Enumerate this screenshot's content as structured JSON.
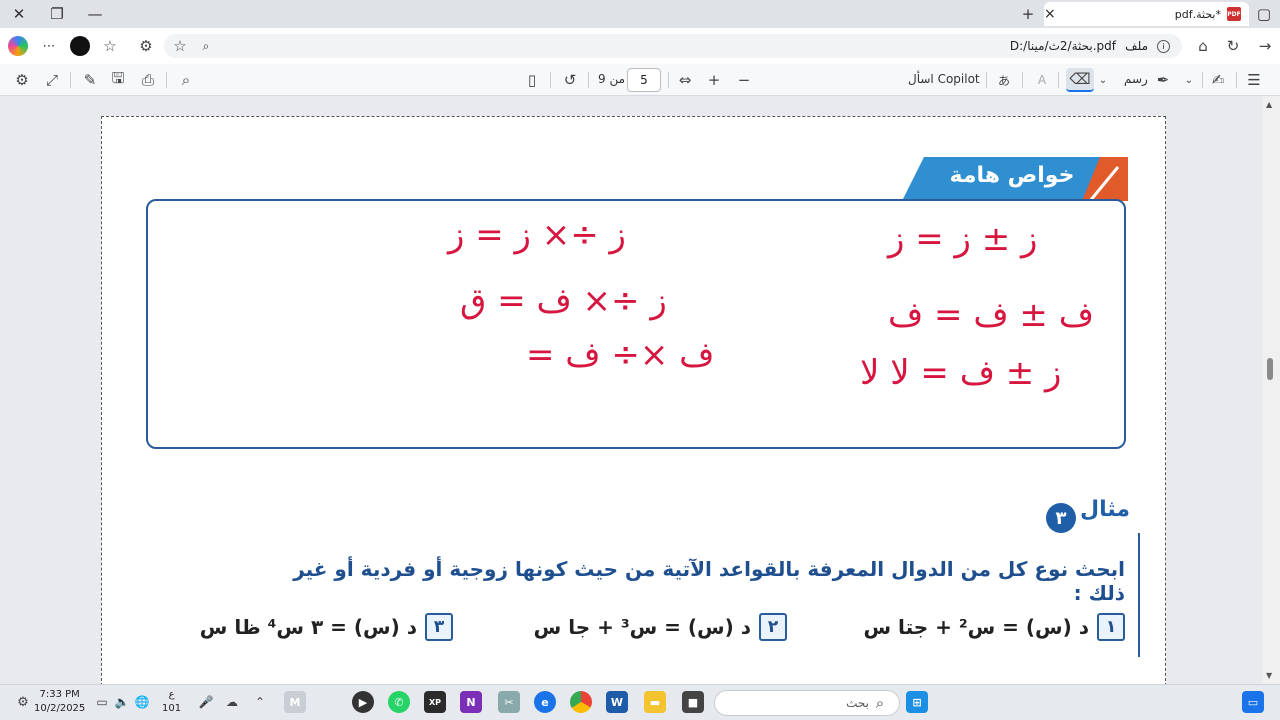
{
  "browser": {
    "tab_title": "*بحثة.pdf",
    "pdf_badge": "PDF",
    "new_tab": "+",
    "close_tab": "×",
    "address_label": "ملف",
    "address_url": "D:/بحثة/2ث/مينا.pdf"
  },
  "toolbar": {
    "page_current": "5",
    "page_of": "من 9",
    "ask_copilot": "اسأل Copilot",
    "draw_label": "رسم",
    "read_aloud": "A"
  },
  "document": {
    "banner_title": "خواص هامة",
    "handwriting": {
      "r1": "ز ± ز = ز",
      "r2": "ف ± ف = ف",
      "r3": "ز ± ف = لا لا",
      "l1": "ز ÷× ز = ز",
      "l2": "ز ÷× ف = ق",
      "l3": "ف ×÷ ف ="
    },
    "example_number": "٣",
    "example_title": "مثال",
    "question": "ابحث نوع كل من الدوال المعرفة بالقواعد الآتية من حيث كونها زوجية أو فردية أو غير ذلك :",
    "functions": [
      {
        "num": "١",
        "text": "د (س) = س² + جتا س"
      },
      {
        "num": "٢",
        "text": "د (س) = س³ + جا س"
      },
      {
        "num": "٣",
        "text": "د (س) = ٣ س⁴ ظا س"
      }
    ]
  },
  "taskbar": {
    "search_placeholder": "بحث",
    "time": "7:33 PM",
    "date": "10/2/2025",
    "lang": "ع",
    "lang_code": "101"
  }
}
